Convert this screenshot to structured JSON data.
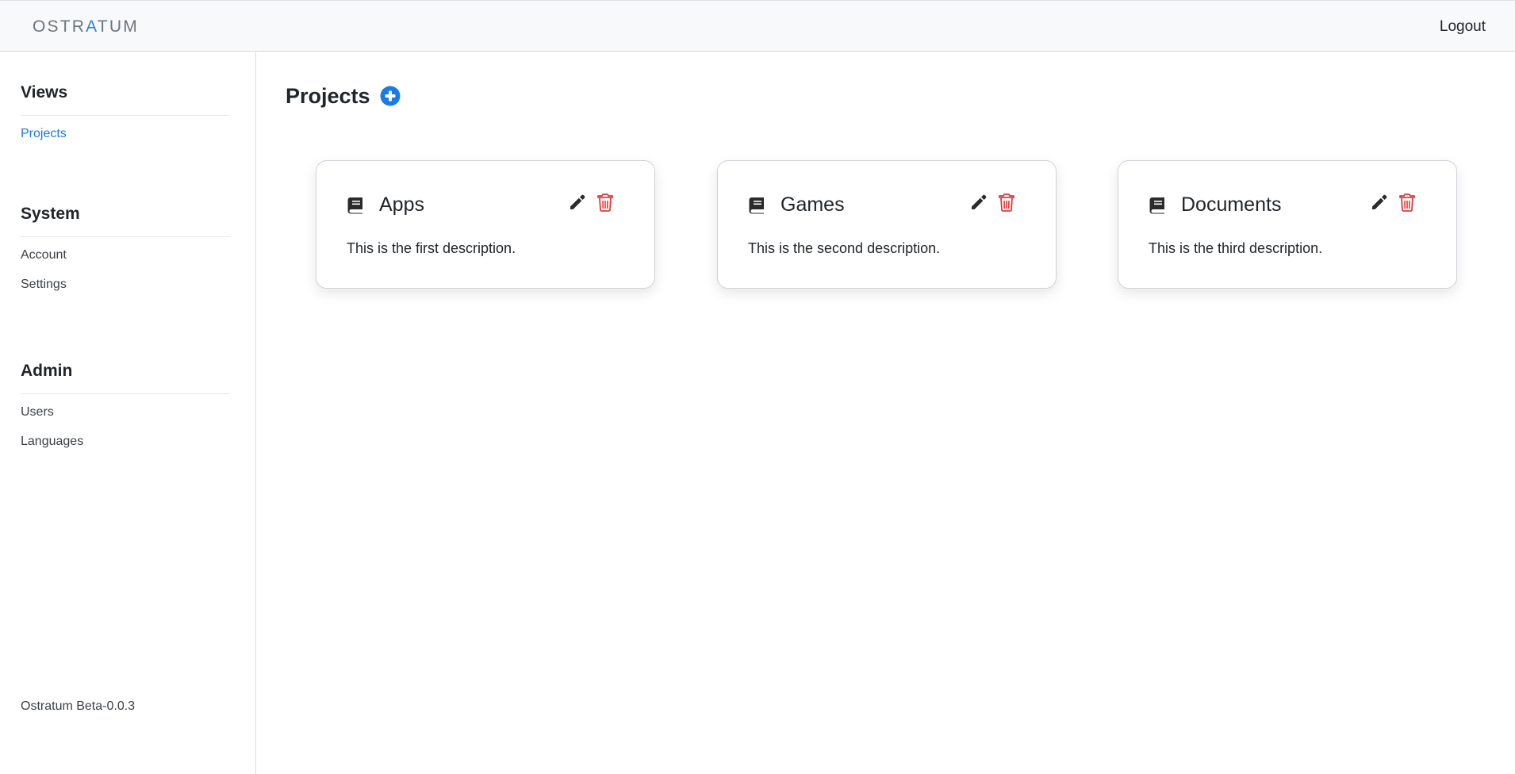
{
  "header": {
    "logo_pre": "OSTR",
    "logo_accent": "A",
    "logo_post": "TUM",
    "logout_label": "Logout"
  },
  "sidebar": {
    "sections": [
      {
        "title": "Views",
        "items": [
          {
            "label": "Projects",
            "active": true
          }
        ]
      },
      {
        "title": "System",
        "items": [
          {
            "label": "Account"
          },
          {
            "label": "Settings"
          }
        ]
      },
      {
        "title": "Admin",
        "items": [
          {
            "label": "Users"
          },
          {
            "label": "Languages"
          }
        ]
      }
    ],
    "version": "Ostratum Beta-0.0.3"
  },
  "main": {
    "title": "Projects",
    "add_icon": "plus-circle-icon",
    "projects": [
      {
        "name": "Apps",
        "description": "This is the first description.",
        "icon": "book-icon"
      },
      {
        "name": "Games",
        "description": "This is the second description.",
        "icon": "book-icon"
      },
      {
        "name": "Documents",
        "description": "This is the third description.",
        "icon": "book-icon"
      }
    ]
  },
  "colors": {
    "accent": "#1a7ae6",
    "delete": "#e03a3a",
    "topbar_bg": "#f8f9fb"
  }
}
